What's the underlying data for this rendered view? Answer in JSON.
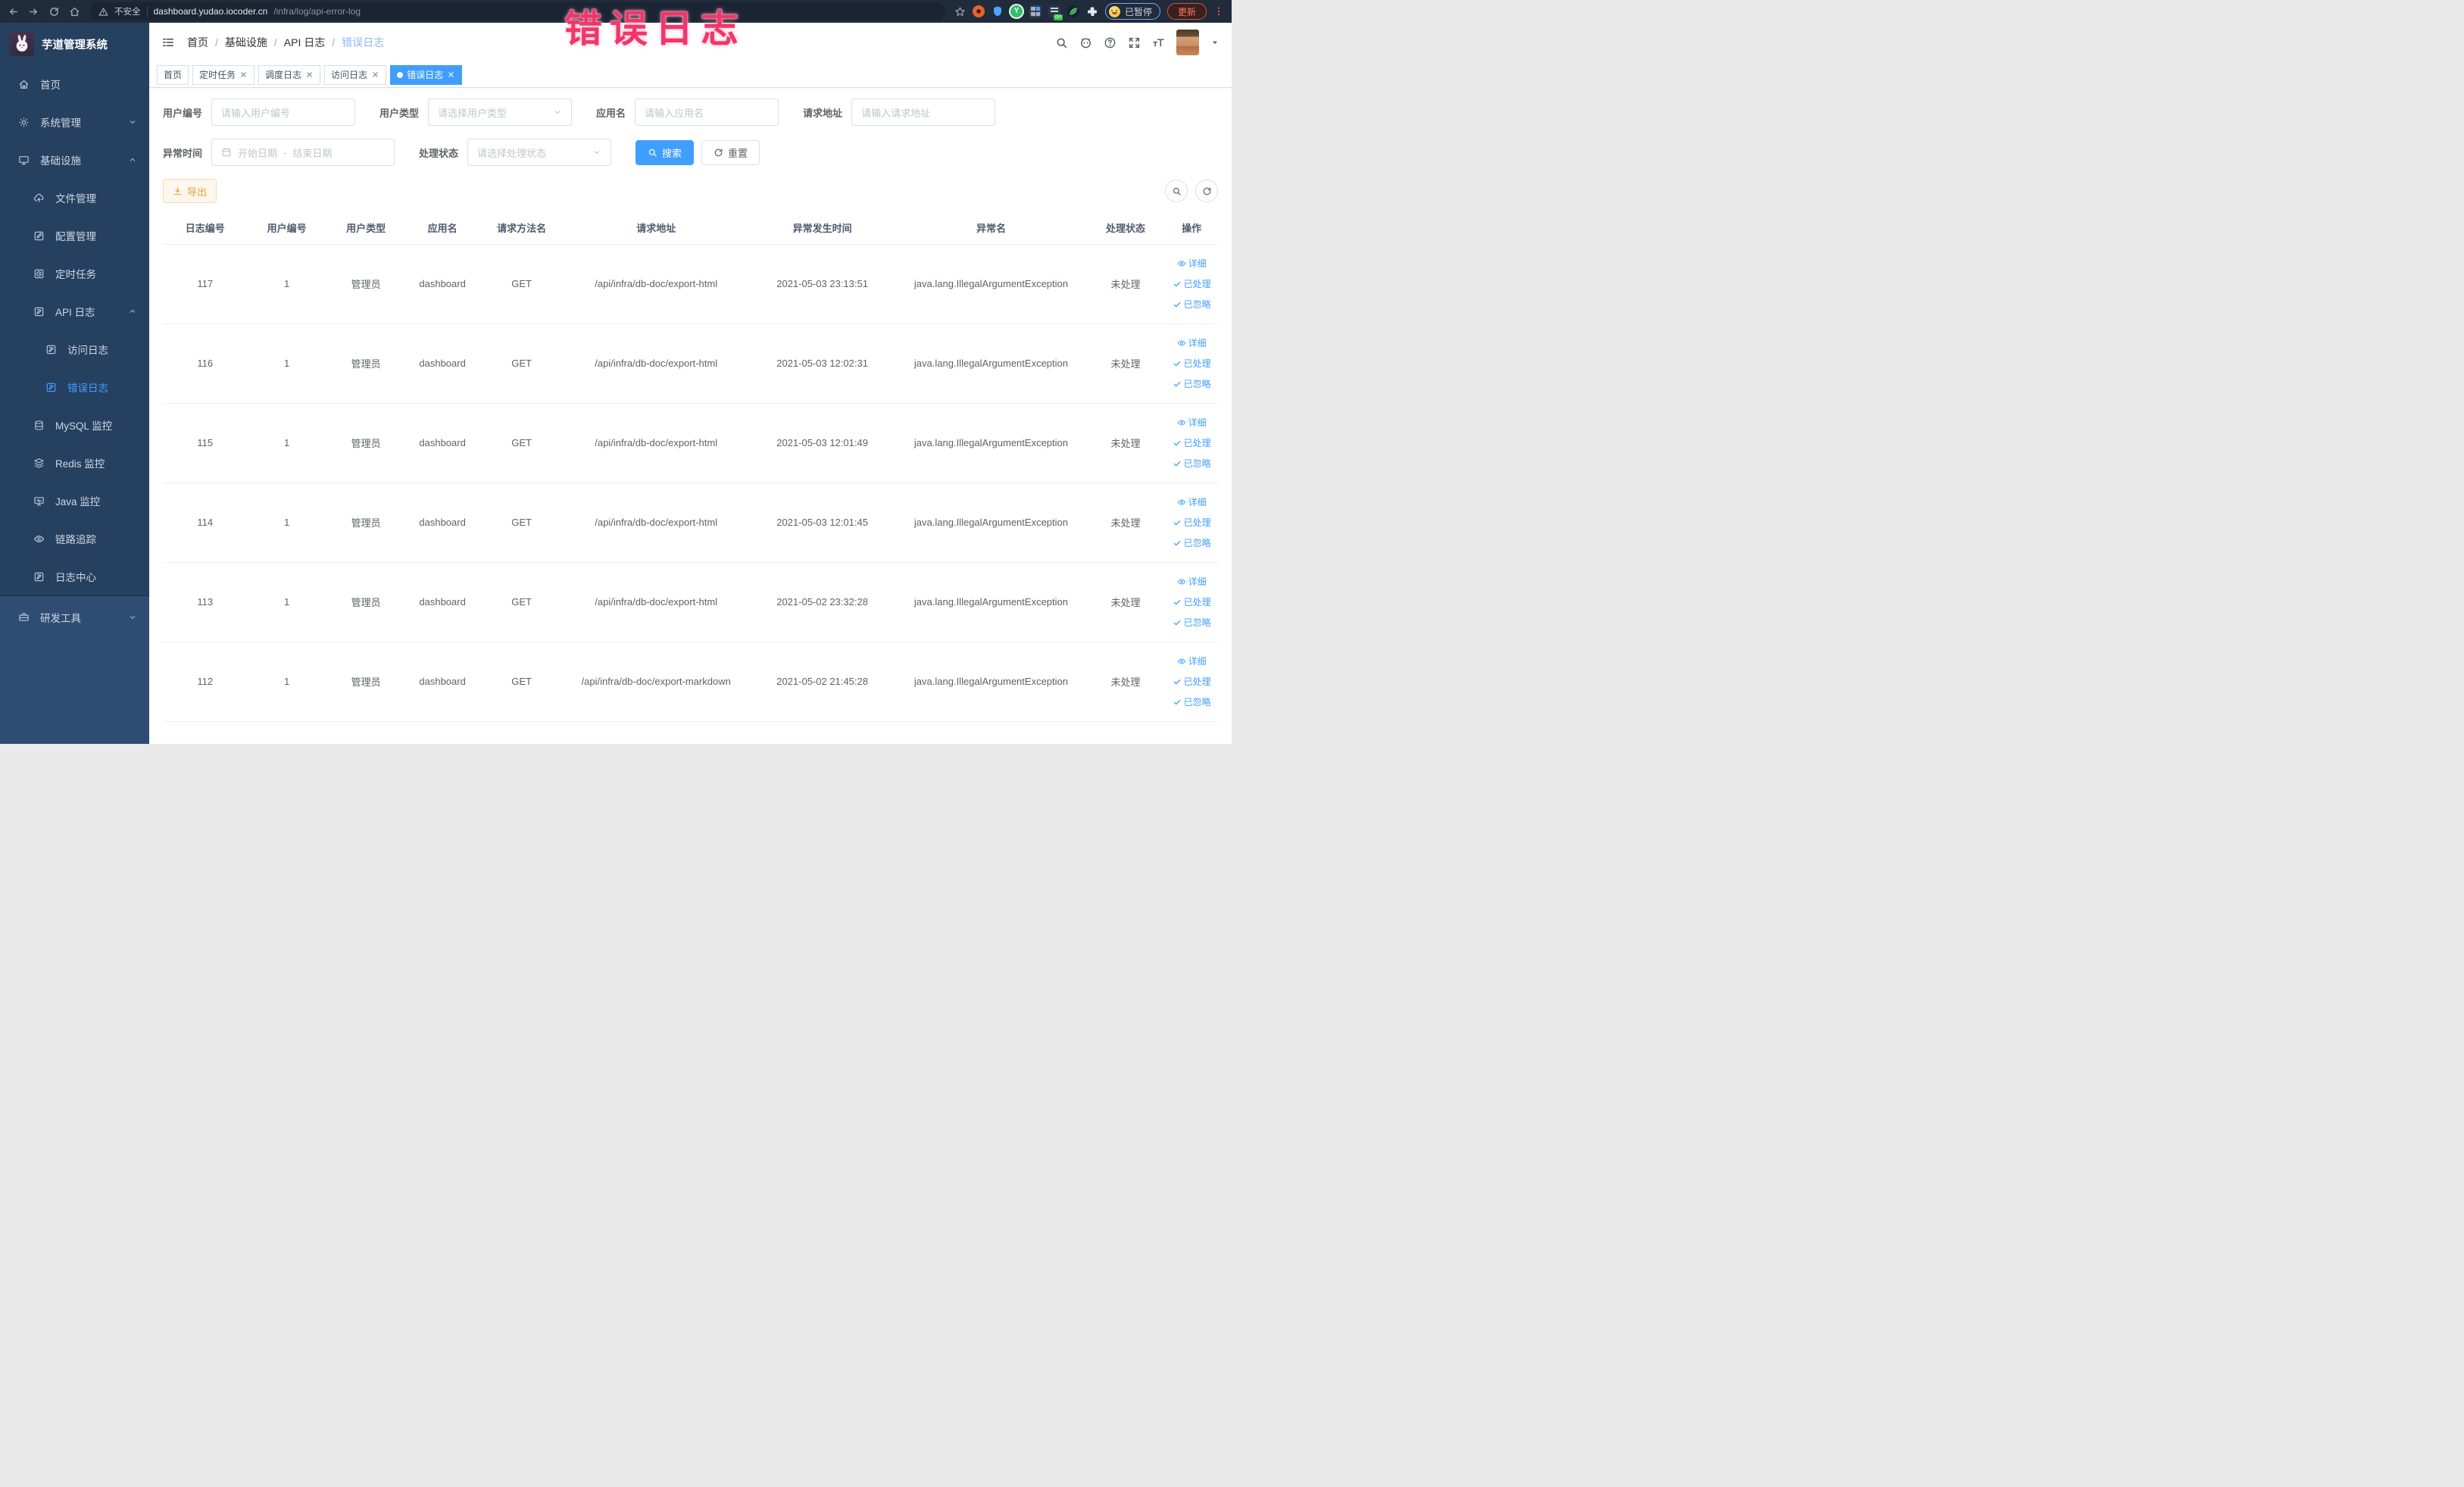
{
  "overlay": {
    "text": "错误日志"
  },
  "colors": {
    "accent": "#409eff",
    "warning": "#e6a23c",
    "overlay_pink": "#f0366a",
    "sidebar_bg": "#26405f",
    "sidebar_bg_light": "#2f4d73",
    "browser_bar_bg": "#202c3c",
    "update_red": "#ff7a5c"
  },
  "icons": {
    "browser": [
      "back-arrow",
      "forward-arrow",
      "reload",
      "home",
      "warning-triangle",
      "star",
      "puzzle-extensions"
    ],
    "navbar": [
      "hamburger",
      "search-magnifier",
      "github-octocat",
      "help-question",
      "fullscreen-arrows",
      "font-size",
      "avatar",
      "caret-down"
    ],
    "table_actions": [
      "eye",
      "check",
      "check"
    ]
  },
  "browser": {
    "security_label": "不安全",
    "url_host": "dashboard.yudao.iocoder.cn",
    "url_path": "/infra/log/api-error-log",
    "paused_label": "已暂停",
    "update_label": "更新"
  },
  "sidebar": {
    "app_title": "芋道管理系统",
    "items": [
      {
        "label": "首页"
      },
      {
        "label": "系统管理"
      },
      {
        "label": "基础设施"
      },
      {
        "label": "文件管理"
      },
      {
        "label": "配置管理"
      },
      {
        "label": "定时任务"
      },
      {
        "label": "API 日志"
      },
      {
        "label": "访问日志"
      },
      {
        "label": "错误日志"
      },
      {
        "label": "MySQL 监控"
      },
      {
        "label": "Redis 监控"
      },
      {
        "label": "Java 监控"
      },
      {
        "label": "链路追踪"
      },
      {
        "label": "日志中心"
      },
      {
        "label": "研发工具"
      }
    ]
  },
  "header": {
    "separator": "/",
    "breadcrumb": [
      "首页",
      "基础设施",
      "API 日志",
      "错误日志"
    ]
  },
  "tabs": [
    {
      "label": "首页"
    },
    {
      "label": "定时任务"
    },
    {
      "label": "调度日志"
    },
    {
      "label": "访问日志"
    },
    {
      "label": "错误日志"
    }
  ],
  "filters": {
    "user_id": {
      "label": "用户编号",
      "placeholder": "请输入用户编号"
    },
    "user_type": {
      "label": "用户类型",
      "placeholder": "请选择用户类型"
    },
    "app_name": {
      "label": "应用名",
      "placeholder": "请输入应用名"
    },
    "request_url": {
      "label": "请求地址",
      "placeholder": "请输入请求地址"
    },
    "exception_time": {
      "label": "异常时间",
      "start_placeholder": "开始日期",
      "separator": "-",
      "end_placeholder": "结束日期"
    },
    "process_status": {
      "label": "处理状态",
      "placeholder": "请选择处理状态"
    },
    "search_label": "搜索",
    "reset_label": "重置"
  },
  "toolbar": {
    "export_label": "导出"
  },
  "table": {
    "columns": [
      "日志编号",
      "用户编号",
      "用户类型",
      "应用名",
      "请求方法名",
      "请求地址",
      "异常发生时间",
      "异常名",
      "处理状态",
      "操作"
    ],
    "action_labels": {
      "detail": "详细",
      "processed": "已处理",
      "ignored": "已忽略"
    },
    "rows": [
      {
        "id": "117",
        "user_id": "1",
        "user_type": "管理员",
        "app": "dashboard",
        "method": "GET",
        "url": "/api/infra/db-doc/export-html",
        "time": "2021-05-03 23:13:51",
        "exception": "java.lang.IllegalArgumentException",
        "status": "未处理"
      },
      {
        "id": "116",
        "user_id": "1",
        "user_type": "管理员",
        "app": "dashboard",
        "method": "GET",
        "url": "/api/infra/db-doc/export-html",
        "time": "2021-05-03 12:02:31",
        "exception": "java.lang.IllegalArgumentException",
        "status": "未处理"
      },
      {
        "id": "115",
        "user_id": "1",
        "user_type": "管理员",
        "app": "dashboard",
        "method": "GET",
        "url": "/api/infra/db-doc/export-html",
        "time": "2021-05-03 12:01:49",
        "exception": "java.lang.IllegalArgumentException",
        "status": "未处理"
      },
      {
        "id": "114",
        "user_id": "1",
        "user_type": "管理员",
        "app": "dashboard",
        "method": "GET",
        "url": "/api/infra/db-doc/export-html",
        "time": "2021-05-03 12:01:45",
        "exception": "java.lang.IllegalArgumentException",
        "status": "未处理"
      },
      {
        "id": "113",
        "user_id": "1",
        "user_type": "管理员",
        "app": "dashboard",
        "method": "GET",
        "url": "/api/infra/db-doc/export-html",
        "time": "2021-05-02 23:32:28",
        "exception": "java.lang.IllegalArgumentException",
        "status": "未处理"
      },
      {
        "id": "112",
        "user_id": "1",
        "user_type": "管理员",
        "app": "dashboard",
        "method": "GET",
        "url": "/api/infra/db-doc/export-markdown",
        "time": "2021-05-02 21:45:28",
        "exception": "java.lang.IllegalArgumentException",
        "status": "未处理"
      }
    ]
  }
}
